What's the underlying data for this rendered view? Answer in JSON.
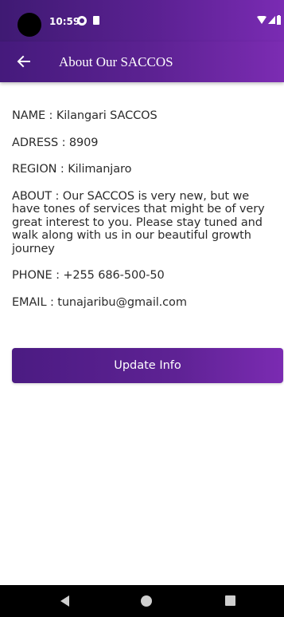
{
  "status_bar": {
    "time": "10:59"
  },
  "app_bar": {
    "title": "About Our SACCOS"
  },
  "info": {
    "name": "NAME : Kilangari SACCOS",
    "address": "ADRESS : 8909",
    "region": "REGION : Kilimanjaro",
    "about": "ABOUT : Our SACCOS is very new, but we have tones of services that might be of very great interest to you. Please stay tuned and walk along with us in our beautiful growth journey",
    "phone": "PHONE : +255 686-500-50",
    "email": "EMAIL : tunajaribu@gmail.com"
  },
  "actions": {
    "update_label": "Update Info"
  },
  "colors": {
    "primary": "#5b2192",
    "primary_light": "#7a2bb3",
    "text": "#2b2b2b",
    "background": "#ffffff"
  },
  "icons": {
    "back": "arrow-left",
    "nav_back": "triangle-left",
    "nav_home": "circle",
    "nav_recents": "square"
  }
}
